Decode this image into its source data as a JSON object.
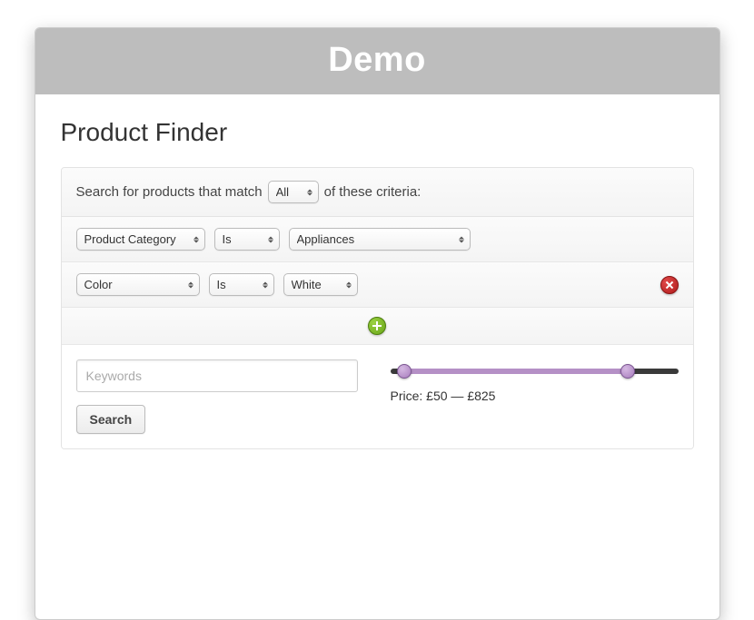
{
  "window": {
    "title": "Demo"
  },
  "page": {
    "title": "Product Finder"
  },
  "match_sentence": {
    "prefix": "Search for products that match",
    "select_value": "All",
    "suffix": "of these criteria:"
  },
  "criteria": [
    {
      "field": "Product Category",
      "operator": "Is",
      "value": "Appliances"
    },
    {
      "field": "Color",
      "operator": "Is",
      "value": "White"
    }
  ],
  "keywords": {
    "placeholder": "Keywords",
    "value": ""
  },
  "price": {
    "label_prefix": "Price:",
    "currency": "£",
    "min": 50,
    "max": 825,
    "range_min": 0,
    "range_max": 1000,
    "display": "Price: £50 — £825"
  },
  "actions": {
    "search": "Search"
  },
  "icons": {
    "add": "plus-icon",
    "remove": "close-icon"
  }
}
